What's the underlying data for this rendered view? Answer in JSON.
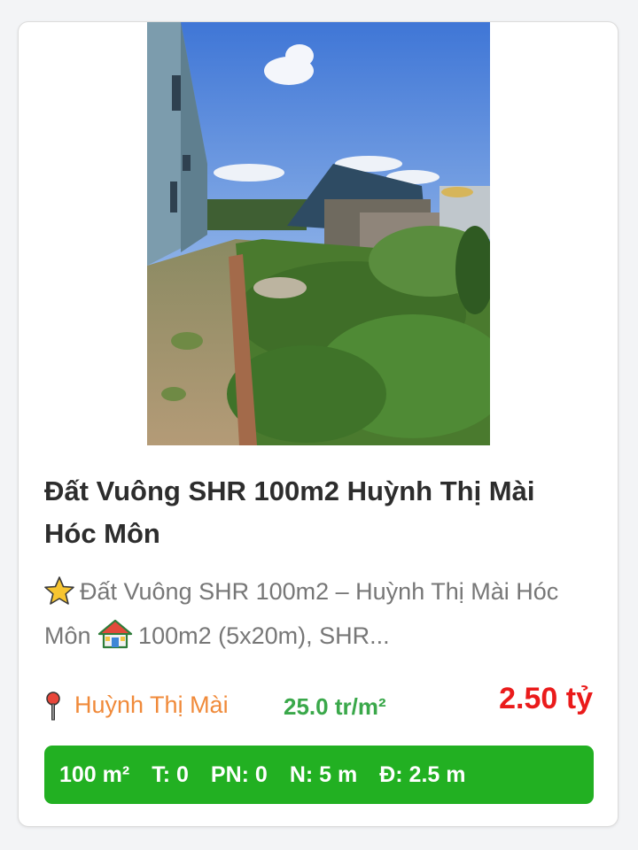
{
  "listing": {
    "image_alt": "Đất Vuông SHR 100m2 Huỳnh Thị Mài Hóc Môn",
    "title": "Đất Vuông SHR 100m2 Huỳnh Thị Mài Hóc Môn",
    "description_part1": "Đất Vuông SHR 100m2 – Huỳnh Thị Mài Hóc Môn",
    "description_part2": "100m2 (5x20m), SHR...",
    "location": "Huỳnh Thị Mài",
    "unit_price": "25.0 tr/m²",
    "price": "2.50 tỷ",
    "specs": {
      "area": "100 m²",
      "floors": "T: 0",
      "bedrooms": "PN: 0",
      "width": "N: 5 m",
      "road": "Đ: 2.5 m"
    }
  },
  "icons": {
    "star": "star-icon",
    "house": "house-icon",
    "pin": "location-pin-icon"
  },
  "colors": {
    "location": "#f08a3a",
    "unit_price": "#3aa84a",
    "price": "#ea1b1b",
    "specs_bg": "#22b022"
  }
}
